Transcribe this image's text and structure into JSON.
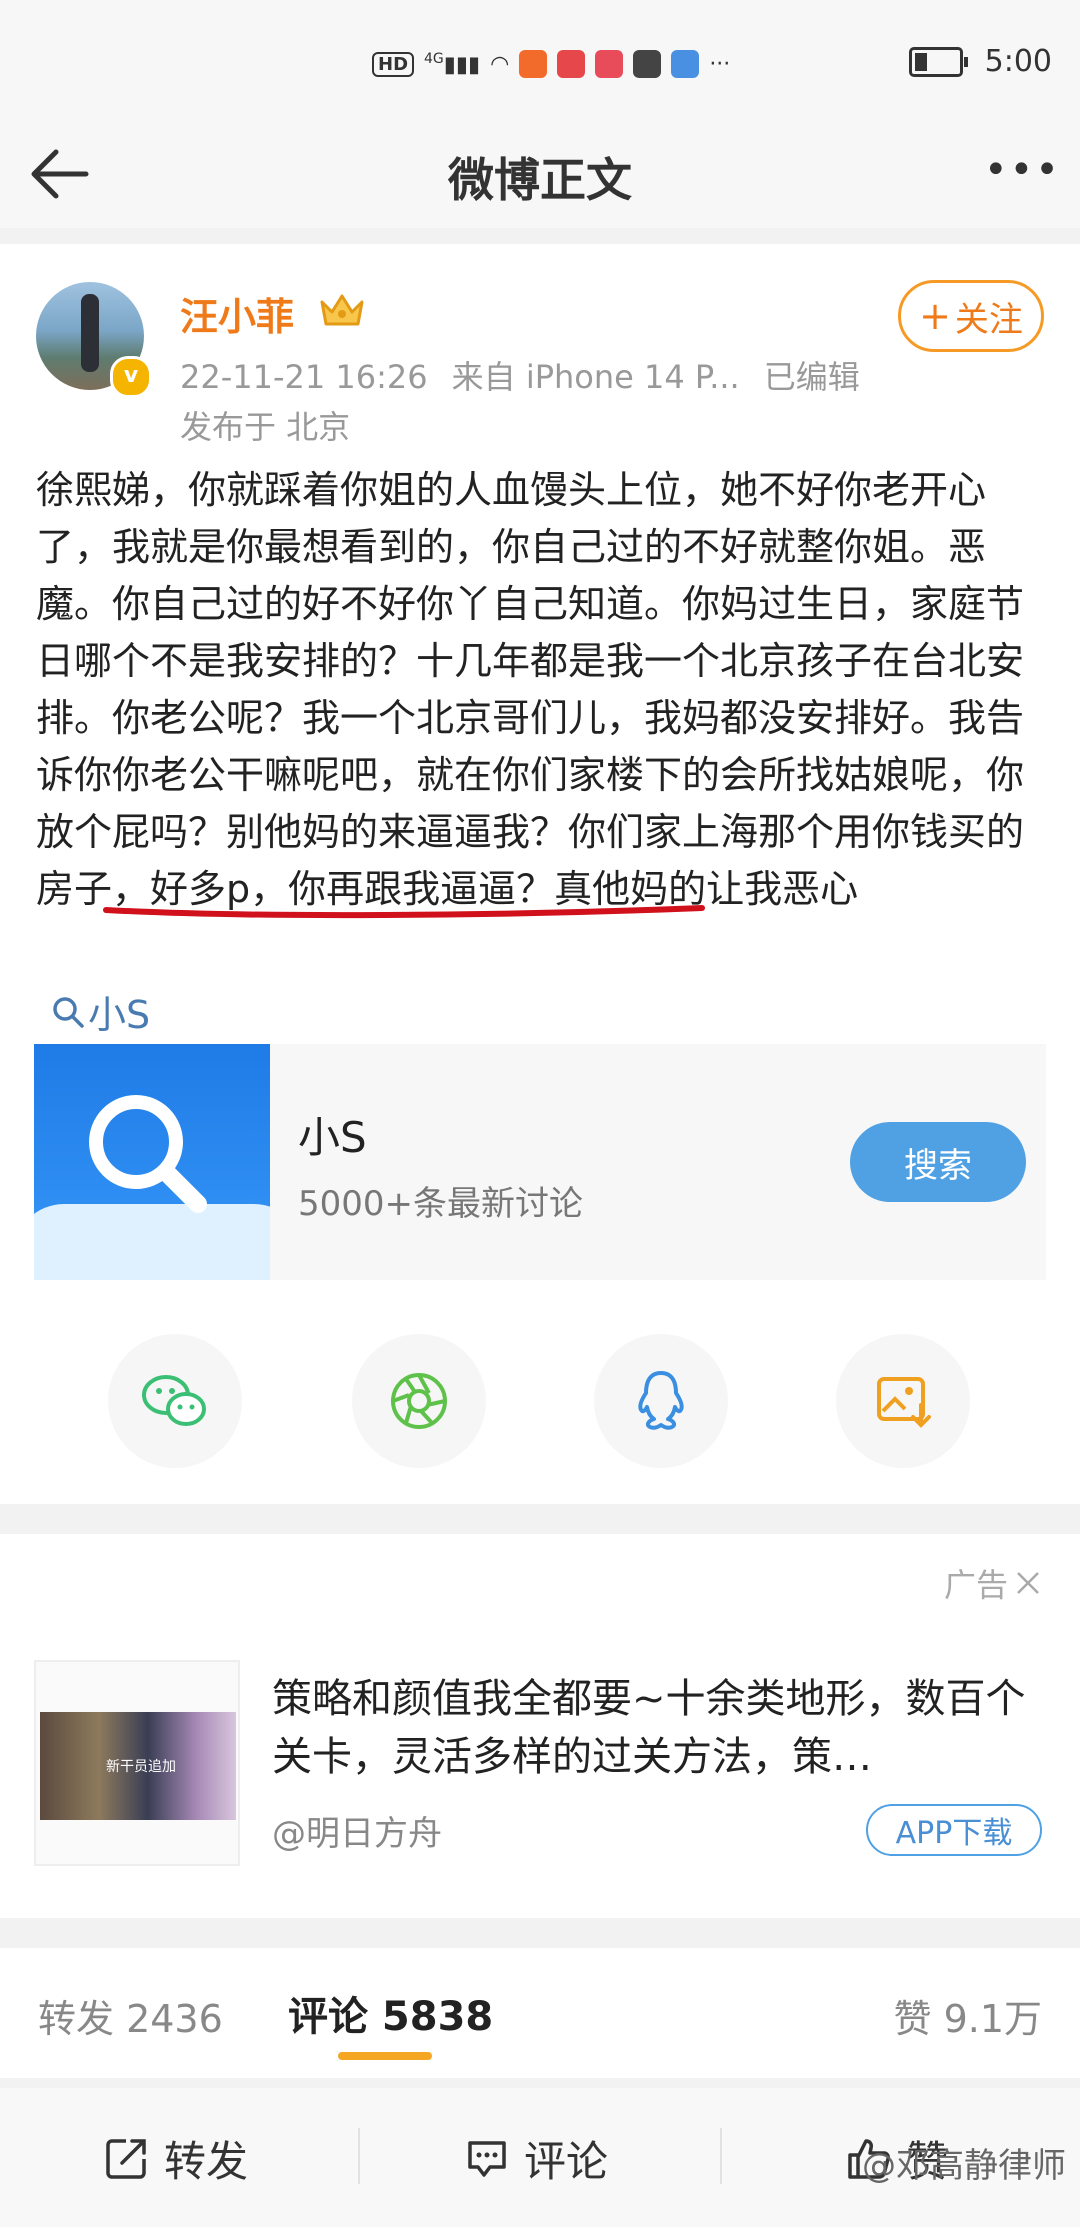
{
  "status_bar": {
    "hd": "HD",
    "network": "4G",
    "more": "···",
    "time": "5:00"
  },
  "nav": {
    "title": "微博正文"
  },
  "post": {
    "author": "汪小菲",
    "timestamp": "22-11-21 16:26",
    "source": "来自 iPhone 14 P...",
    "edited": "已编辑",
    "location": "发布于 北京",
    "follow_label": "关注",
    "text_before": "徐熙娣，你就踩着你姐的人血馒头上位，她不好你老开心了，我就是你最想看到的，你自己过的不好就整你姐。恶魔。你自己过的好不好你丫自己知道。你妈过生日，家庭节日哪个不是我安排的？十几年都是我一个北京孩子在台北安排。你老公呢？我一个北京哥们儿，我妈都没安排好。我告诉你你老公干嘛呢吧，就在你们家楼下的会所找姑娘呢，你放个屁吗？别他妈的来逼逼我？",
    "text_underlined": "你们家上海那个用你钱买的房子",
    "text_after": "，好多p，你再跟我逼逼？真他妈的让我恶心",
    "topic_link": "小S"
  },
  "topic_card": {
    "title": "小S",
    "subtitle": "5000+条最新讨论",
    "search_label": "搜索"
  },
  "share": {
    "icons": [
      "wechat-icon",
      "moments-icon",
      "qq-icon",
      "save-image-icon"
    ]
  },
  "ad": {
    "label": "广告",
    "text": "策略和颜值我全都要~十余类地形，数百个关卡，灵活多样的过关方法，策…",
    "image_caption": "新干员追加",
    "source": "@明日方舟",
    "button": "APP下载"
  },
  "stats": {
    "repost": "转发 2436",
    "comment": "评论 5838",
    "like": "赞 9.1万"
  },
  "toolbar": {
    "repost": "转发",
    "comment": "评论",
    "like": "赞"
  },
  "watermark": "@邓高静律师",
  "colors": {
    "author_orange": "#ef7a1a",
    "link_blue": "#4a7bb0",
    "search_blue": "#4fa1e4",
    "underline_red": "#d0101a",
    "tab_indicator": "#f5a623"
  }
}
